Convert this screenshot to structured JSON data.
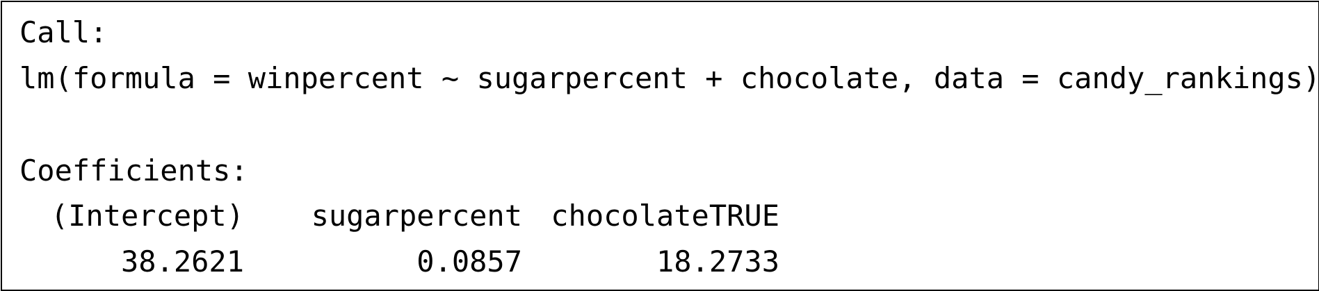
{
  "call_label": "Call:",
  "call_text": "lm(formula = winpercent ~ sugarpercent + chocolate, data = candy_rankings)",
  "coefficients_label": "Coefficients:",
  "coefficients": {
    "headers": [
      "(Intercept)",
      "sugarpercent",
      "chocolateTRUE"
    ],
    "values": [
      "38.2621",
      "0.0857",
      "18.2733"
    ]
  }
}
